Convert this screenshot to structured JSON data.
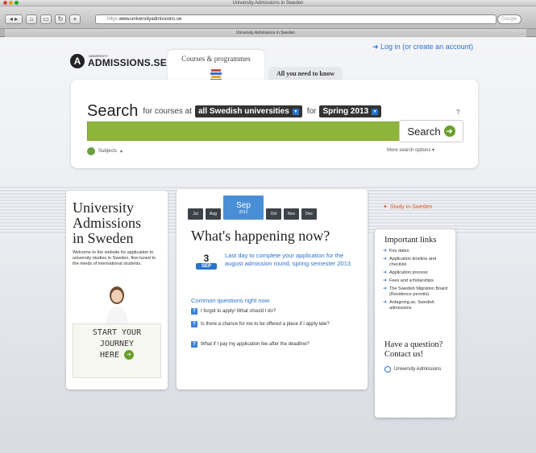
{
  "browser": {
    "window_title": "University Admissions in Sweden",
    "tab_title": "University Admissions in Sweden",
    "url_scheme": "https",
    "url_host": "www.universityadmissions.se",
    "search_placeholder": "Google"
  },
  "header": {
    "login": "Log in (or create an account)",
    "logo_small": "UNIVERSITY",
    "logo_text": "ADMISSIONS.SE",
    "tabs": [
      {
        "label": "Courses & programmes"
      },
      {
        "label": "All you need to know"
      }
    ]
  },
  "search": {
    "title": "Search",
    "for_courses_at": "for courses at",
    "university_value": "all Swedish universities",
    "for_label": "for",
    "term_value": "Spring 2013",
    "help": "?",
    "button_label": "Search",
    "subjects_label": "Subjects",
    "more_options": "More search options"
  },
  "left": {
    "title_lines": [
      "University",
      "Admissions",
      "in Sweden"
    ],
    "welcome": "Welcome to the website for application to university studies in Sweden, fine-tuned to the needs of international students.",
    "journey_lines": [
      "START YOUR",
      "JOURNEY",
      "HERE"
    ]
  },
  "happening": {
    "months": [
      {
        "label": "Jul"
      },
      {
        "label": "Aug"
      },
      {
        "label": "Sep",
        "year": "2012",
        "active": true
      },
      {
        "label": "Oct"
      },
      {
        "label": "Nov"
      },
      {
        "label": "Dec"
      }
    ],
    "title": "What's happening now?",
    "event_day": "3",
    "event_month": "SEP",
    "event_text": "Last day to complete your application for the august admission round, spring semester 2013",
    "questions_heading": "Common questions right now",
    "questions": [
      "I forgot to apply! What should I do?",
      "Is there a chance for me to be offered a place if I apply late?",
      "What if I pay my application fee after the deadline?"
    ]
  },
  "right": {
    "study": "Study in Sweden",
    "links_title": "Important links",
    "links": [
      "Key dates",
      "Application timeline and checklist",
      "Application process",
      "Fees and scholarships",
      "The Swedish Migration Board (Residence permits)",
      "Antagning.se, Swedish admissions"
    ],
    "question_title": "Have a question? Contact us!",
    "contact": "University Admissions"
  },
  "colors": {
    "accent_blue": "#2a73c9",
    "search_green": "#8fb43c",
    "month_dark": "#3d4248",
    "study_orange": "#e25b2a"
  }
}
